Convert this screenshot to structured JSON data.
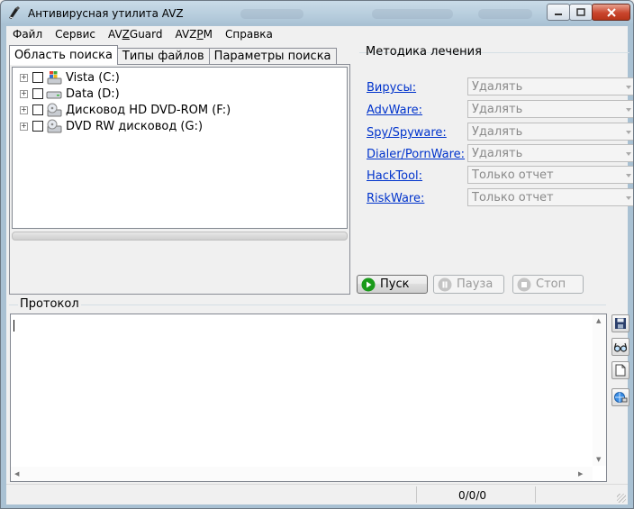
{
  "window": {
    "title": "Антивирусная утилита AVZ"
  },
  "menu": [
    {
      "label": "Файл"
    },
    {
      "label": "Сервис"
    },
    {
      "label_pre": "AV",
      "label_u": "Z",
      "label_post": "Guard"
    },
    {
      "label_pre": "AVZ",
      "label_u": "P",
      "label_post": "M"
    },
    {
      "label": "Справка"
    }
  ],
  "tabs": [
    "Область поиска",
    "Типы файлов",
    "Параметры поиска"
  ],
  "tree": [
    {
      "label": "Vista (C:)",
      "icon": "windows-drive-icon"
    },
    {
      "label": "Data (D:)",
      "icon": "hard-drive-icon"
    },
    {
      "label": "Дисковод HD DVD-ROM (F:)",
      "icon": "dvd-drive-icon"
    },
    {
      "label": "DVD RW дисковод (G:)",
      "icon": "dvd-drive-icon"
    }
  ],
  "treatment": {
    "group_title": "Методика лечения",
    "rows": [
      {
        "link": "Вирусы:",
        "value": "Удалять"
      },
      {
        "link": "AdvWare:",
        "value": "Удалять"
      },
      {
        "link": "Spy/Spyware:",
        "value": "Удалять"
      },
      {
        "link": "Dialer/PornWare:",
        "value": "Удалять"
      },
      {
        "link": "HackTool:",
        "value": "Только отчет"
      },
      {
        "link": "RiskWare:",
        "value": "Только отчет"
      }
    ]
  },
  "buttons": {
    "start": "Пуск",
    "pause": "Пауза",
    "stop": "Стоп"
  },
  "protocol": {
    "title": "Протокол",
    "text": ""
  },
  "side_buttons": [
    "save-icon",
    "glasses-icon",
    "document-icon",
    "network-icon"
  ],
  "status": {
    "counter": "0/0/0"
  },
  "colors": {
    "link": "#0033cc",
    "start_icon": "#1a9a1a"
  }
}
